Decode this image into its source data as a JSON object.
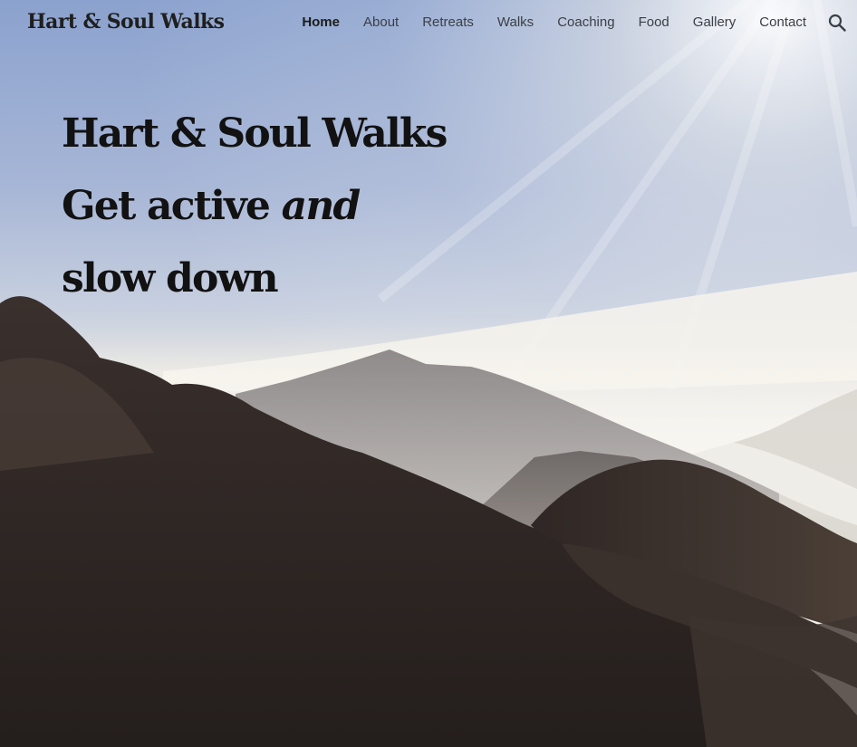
{
  "header": {
    "site_title": "Hart & Soul Walks",
    "nav": [
      {
        "label": "Home",
        "active": true
      },
      {
        "label": "About",
        "active": false
      },
      {
        "label": "Retreats",
        "active": false
      },
      {
        "label": "Walks",
        "active": false
      },
      {
        "label": "Coaching",
        "active": false
      },
      {
        "label": "Food",
        "active": false
      },
      {
        "label": "Gallery",
        "active": false
      },
      {
        "label": "Contact",
        "active": false
      }
    ],
    "search_icon": "search-icon"
  },
  "hero": {
    "title": "Hart & Soul Walks",
    "tagline_before": "Get active ",
    "tagline_emphasis": "and",
    "tagline_after": " slow down",
    "background": "mountain-landscape-photo"
  },
  "colors": {
    "sky_top": "#8aa3cf",
    "sky_mid": "#bcc9de",
    "haze": "#f1efe8",
    "rock_dark": "#2a2422",
    "text_dark": "#121212",
    "nav_text": "#3b3f46"
  }
}
